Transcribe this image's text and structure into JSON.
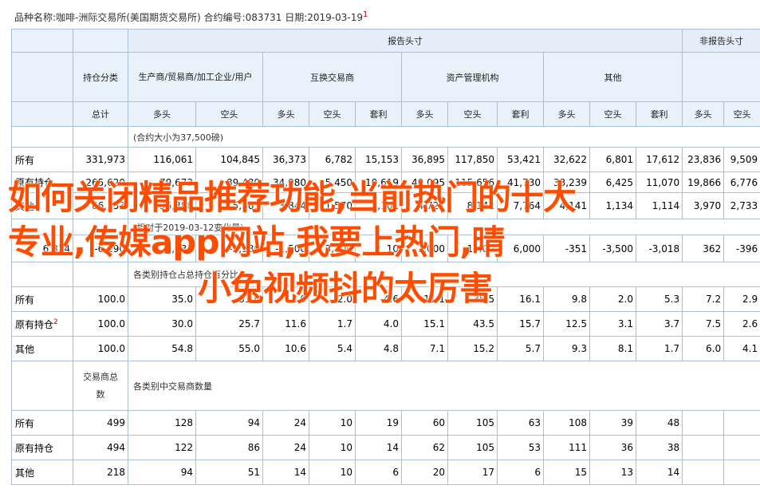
{
  "header_line": {
    "text": "品种名称:咖啡-洲际交易所(美国期货交易所)    合约编号:083731    日期:2019-03-19",
    "note": "1"
  },
  "table": {
    "group_reportable": "报告头寸",
    "group_nonreportable": "非报告头寸",
    "holding_category": "持仓分类",
    "producer": "生产商/贸易商/加工企业/用户",
    "swap_dealer": "互换交易商",
    "managed_money": "资产管理机构",
    "other": "其他",
    "total": "总计",
    "long": "多头",
    "short": "空头",
    "spread": "套利",
    "contract_unit": "(合约大小为37,500磅)",
    "change_note": "(相对于2019-03-12变化量)",
    "pct_note": "各类别持仓占总持仓百分比",
    "trader_count_label": "交易商总数",
    "trader_count_note": "各类别中交易商数量",
    "row_all": "所有",
    "row_old": "原有持仓",
    "row_other": "其他",
    "row_old_note": "2",
    "positions": {
      "all": [
        "331,973",
        "116,061",
        "104,845",
        "36,373",
        "6,782",
        "15,153",
        "36,895",
        "117,850",
        "53,421",
        "32,622",
        "6,801",
        "17,612",
        "23,836",
        "9,509"
      ],
      "old": [
        "265,620",
        "79,673",
        "89,480",
        "34,980",
        "5,450",
        "10,619",
        "40,095",
        "115,656",
        "41,730",
        "33,239",
        "6,425",
        "11,070",
        "19,866",
        "6,776"
      ],
      "other": [
        "66,353",
        "36,388",
        "15,365",
        "3,844",
        "1,570",
        "2,101",
        "4,721",
        "8,141",
        "7,764",
        "4,141",
        "1,134",
        "1,114",
        "3,970",
        "2,733"
      ]
    },
    "changes": [
      "6,824",
      "-6,190",
      "-3,233",
      "-2,180",
      "-1,500",
      "3,100",
      "10",
      "1,000",
      "1,400",
      "6,000",
      "-351",
      "-3,500",
      "-3,018",
      "362",
      "-396"
    ],
    "percent": {
      "all": [
        "100.0",
        "35.0",
        "31.6",
        "11.0",
        "2.0",
        "4.6",
        "11.1",
        "35.5",
        "16.1",
        "9.8",
        "2.0",
        "5.3",
        "7.2",
        "2.9"
      ],
      "old": [
        "100.0",
        "30.0",
        "25.7",
        "11.6",
        "1.7",
        "4.0",
        "15.1",
        "43.5",
        "15.7",
        "12.5",
        "3.1",
        "3.7",
        "7.5",
        "2.6"
      ],
      "other": [
        "100.0",
        "54.8",
        "55.0",
        "10.6",
        "5.4",
        "4.8",
        "7.1",
        "15.2",
        "5.7",
        "9.3",
        "8.1",
        "1.7",
        "6.0",
        "4.1"
      ]
    },
    "traders": {
      "all": [
        "499",
        "128",
        "94",
        "24",
        "10",
        "19",
        "60",
        "105",
        "63",
        "108",
        "39",
        "48"
      ],
      "old": [
        "494",
        "122",
        "86",
        "24",
        "10",
        "14",
        "62",
        "105",
        "53",
        "111",
        "36",
        "38"
      ],
      "other": [
        "218",
        "94",
        "51",
        "14",
        "10",
        "6",
        "20",
        "17",
        "6",
        "15",
        "13",
        "14"
      ]
    }
  },
  "overlay": {
    "line1": "如何关闭精品推荐功能,当前热门的十大",
    "line2": "专业,传媒app网站,我要上热门,晴",
    "line3": "小兔视频抖的太厉害"
  },
  "colors": {
    "header_bg": "#e5eef8",
    "border": "#a9c0d8",
    "note": "#c00000",
    "overlay_text": "#ff4c00"
  }
}
